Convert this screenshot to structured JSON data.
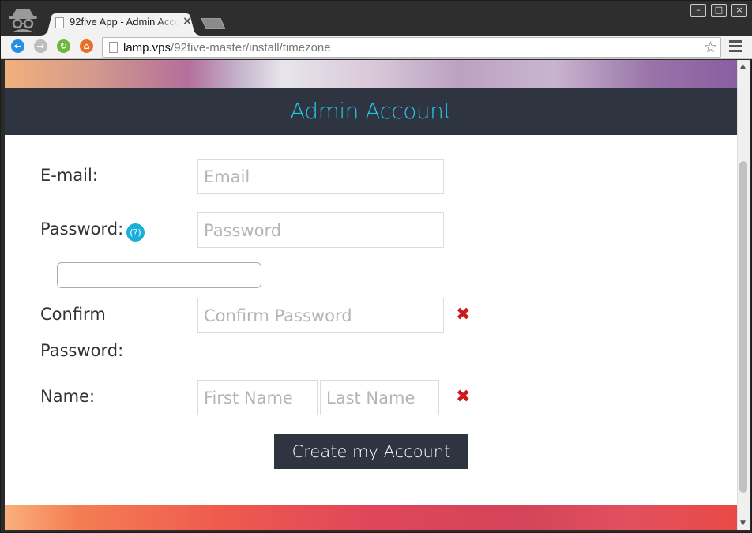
{
  "browser": {
    "tab_title": "92five App - Admin Acco",
    "tab_close": "×",
    "url_host": "lamp.vps",
    "url_path": "/92five-master/install/timezone",
    "window_buttons": {
      "minimize": "–",
      "maximize": "□",
      "close": "×"
    }
  },
  "page": {
    "header_title": "Admin Account",
    "form": {
      "email_label": "E-mail:",
      "email_placeholder": "Email",
      "password_label": "Password:",
      "password_help": "(?)",
      "password_placeholder": "Password",
      "confirm_label_line1": "Confirm",
      "confirm_label_line2": "Password:",
      "confirm_placeholder": "Confirm Password",
      "name_label": "Name:",
      "first_name_placeholder": "First Name",
      "last_name_placeholder": "Last Name",
      "error_mark": "✖",
      "submit_label": "Create my Account"
    }
  },
  "colors": {
    "header_bg": "#2e3440",
    "header_title": "#27c4e8",
    "error": "#cc1a1a",
    "help_icon": "#1aafd8"
  }
}
